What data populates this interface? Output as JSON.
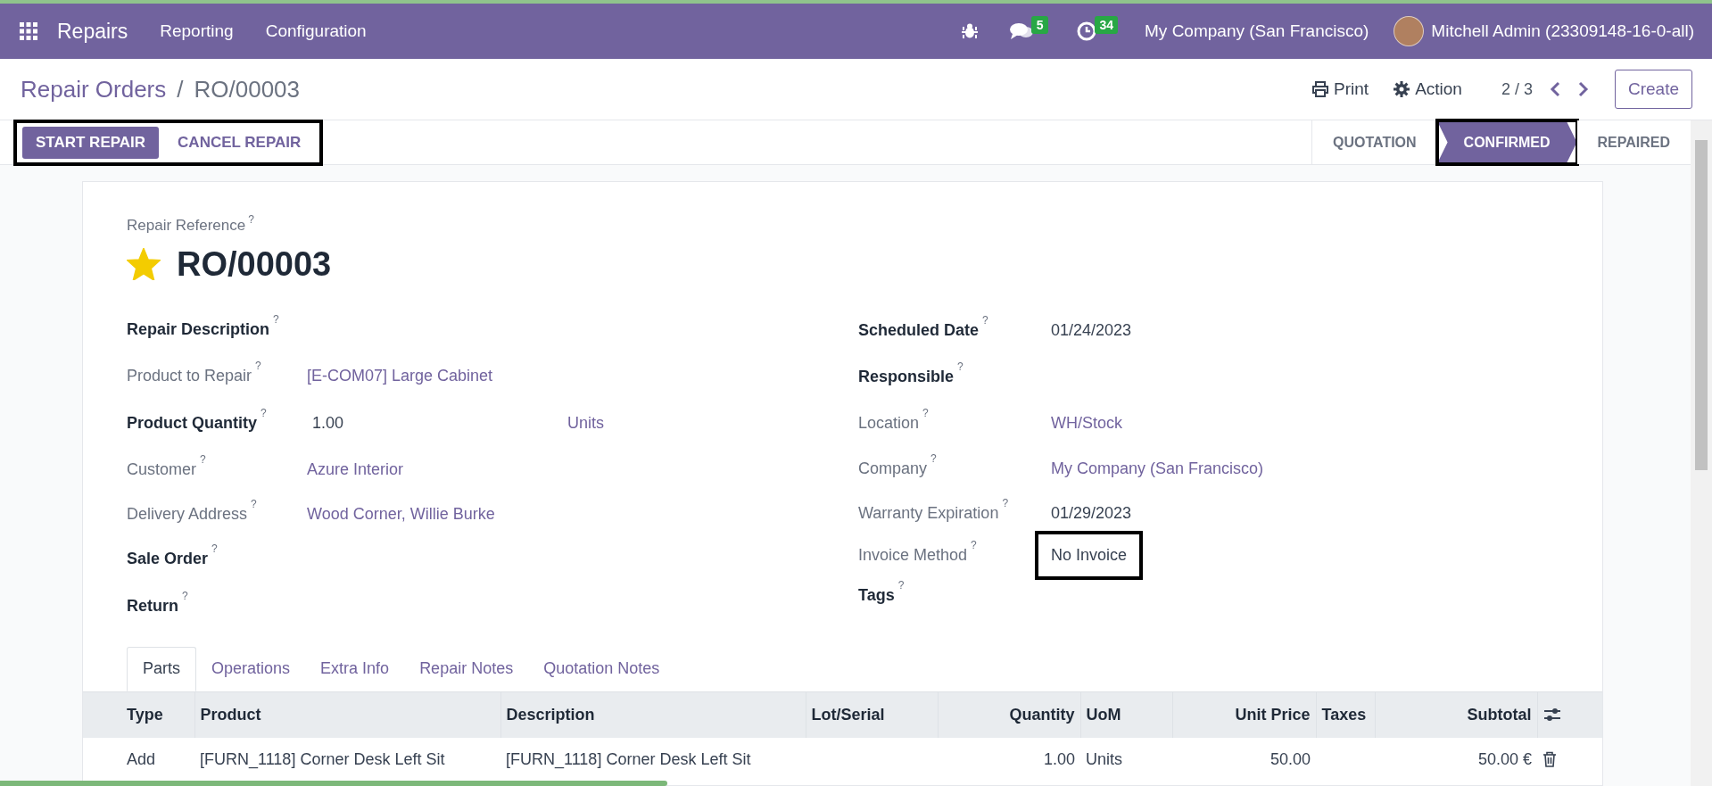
{
  "navbar": {
    "app_name": "Repairs",
    "menus": [
      "Reporting",
      "Configuration"
    ],
    "messages_badge": "5",
    "activities_badge": "34",
    "company": "My Company (San Francisco)",
    "user": "Mitchell Admin (23309148-16-0-all)"
  },
  "breadcrumb": [
    "Repair Orders",
    "RO/00003"
  ],
  "breadcrumb_separator": "/",
  "control_panel": {
    "print": "Print",
    "action": "Action",
    "pager": "2 / 3",
    "create": "Create"
  },
  "actions": {
    "highlighted": true,
    "buttons": [
      {
        "label": "START REPAIR",
        "kind": "primary"
      },
      {
        "label": "CANCEL REPAIR",
        "kind": "secondary"
      }
    ]
  },
  "statusbar": [
    {
      "label": "QUOTATION",
      "selected": false,
      "highlighted": false
    },
    {
      "label": "CONFIRMED",
      "selected": true,
      "highlighted": true
    },
    {
      "label": "REPAIRED",
      "selected": false,
      "highlighted": false
    }
  ],
  "form": {
    "reference_label": "Repair Reference",
    "reference_help": "?",
    "starred": true,
    "title": "RO/00003",
    "left_fields": [
      {
        "label": "Repair Description",
        "required": true,
        "help": "?"
      },
      {
        "label": "Product to Repair",
        "required": false,
        "help": "?",
        "value": "[E-COM07] Large Cabinet",
        "link": true
      },
      {
        "label": "Product Quantity",
        "required": true,
        "help": "?",
        "value": "1.00",
        "link": false,
        "unit": "Units"
      },
      {
        "label": "Customer",
        "required": false,
        "help": "?",
        "value": "Azure Interior",
        "link": true
      },
      {
        "label": "Delivery Address",
        "required": false,
        "help": "?",
        "value": "Wood Corner, Willie Burke",
        "link": true
      },
      {
        "label": "Sale Order",
        "required": true,
        "help": "?"
      },
      {
        "label": "Return",
        "required": true,
        "help": "?"
      }
    ],
    "right_fields": [
      {
        "label": "Scheduled Date",
        "required": true,
        "help": "?",
        "value": "01/24/2023",
        "link": false
      },
      {
        "label": "Responsible",
        "required": true,
        "help": "?"
      },
      {
        "label": "Location",
        "required": false,
        "help": "?",
        "value": "WH/Stock",
        "link": true
      },
      {
        "label": "Company",
        "required": false,
        "help": "?",
        "value": "My Company (San Francisco)",
        "link": true
      },
      {
        "label": "Warranty Expiration",
        "required": false,
        "help": "?",
        "value": "01/29/2023",
        "link": false
      },
      {
        "label": "Invoice Method",
        "required": false,
        "help": "?",
        "value": "No Invoice",
        "link": false,
        "highlighted": true
      },
      {
        "label": "Tags",
        "required": true,
        "help": "?"
      }
    ]
  },
  "tabs": [
    {
      "label": "Parts",
      "selected": true
    },
    {
      "label": "Operations",
      "selected": false
    },
    {
      "label": "Extra Info",
      "selected": false
    },
    {
      "label": "Repair Notes",
      "selected": false
    },
    {
      "label": "Quotation Notes",
      "selected": false
    }
  ],
  "table": {
    "columns": [
      "Type",
      "Product",
      "Description",
      "Lot/Serial",
      "Quantity",
      "UoM",
      "Unit Price",
      "Taxes",
      "Subtotal"
    ],
    "rows": [
      {
        "cells": [
          "Add",
          "[FURN_1118] Corner Desk Left Sit",
          "[FURN_1118] Corner Desk Left Sit",
          "",
          "1.00",
          "Units",
          "50.00",
          "",
          "50.00 €"
        ]
      }
    ]
  },
  "loading_bar": {
    "level": 0.39
  }
}
